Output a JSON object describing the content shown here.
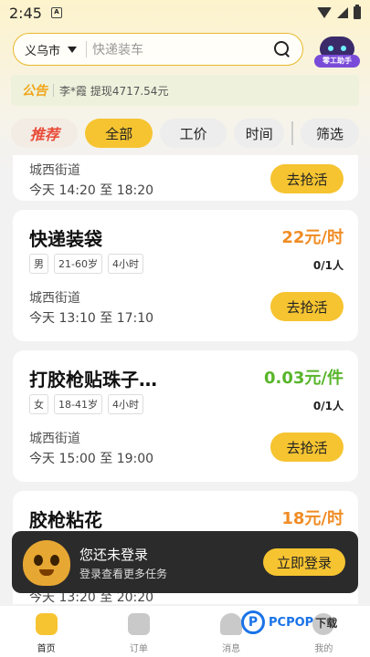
{
  "status_bar": {
    "time": "2:45",
    "sim_label": "A"
  },
  "search": {
    "city": "义乌市",
    "placeholder": "快递装车"
  },
  "assistant": {
    "label": "零工助手"
  },
  "notice": {
    "tag": "公告",
    "text": "李*霞 提现4717.54元"
  },
  "tabs": [
    "推荐",
    "全部",
    "工价",
    "时间",
    "筛选"
  ],
  "jobs": [
    {
      "title": "",
      "wage": "",
      "tags": [],
      "count": "",
      "address": "城西街道",
      "period": "今天 14:20 至 18:20",
      "button": "去抢活"
    },
    {
      "title": "快递装袋",
      "wage": "22元/时",
      "tags": [
        "男",
        "21-60岁",
        "4小时"
      ],
      "count": "0/1人",
      "address": "城西街道",
      "period": "今天 13:10 至 17:10",
      "button": "去抢活"
    },
    {
      "title": "打胶枪贴珠子…",
      "wage": "0.03元/件",
      "tags": [
        "女",
        "18-41岁",
        "4小时"
      ],
      "count": "0/1人",
      "address": "城西街道",
      "period": "今天 15:00 至 19:00",
      "button": "去抢活"
    },
    {
      "title": "胶枪粘花",
      "wage": "18元/时",
      "tags": [],
      "count": "",
      "address": "",
      "period": "今天 13:20 至 20:20",
      "button": ""
    }
  ],
  "login_banner": {
    "title": "您还未登录",
    "subtitle": "登录查看更多任务",
    "button": "立即登录"
  },
  "nav": {
    "home": "首页",
    "orders": "订单",
    "messages": "消息",
    "mine": "我的"
  },
  "watermark": {
    "logo": "P",
    "brand": "PCPOP",
    "suffix": "下载"
  },
  "colors": {
    "accent": "#f6c431",
    "wage_orange": "#f08c24",
    "wage_green": "#58b52a"
  }
}
